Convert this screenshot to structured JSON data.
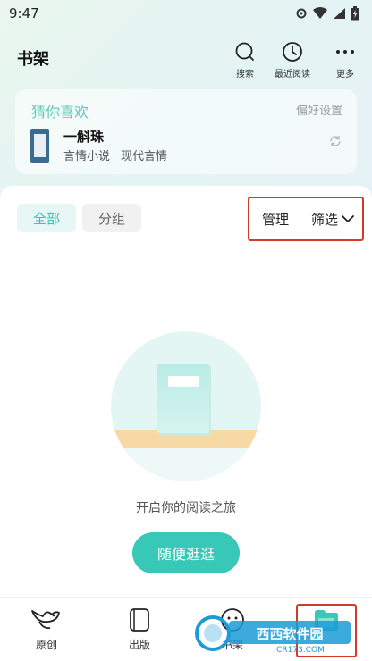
{
  "status_bar": {
    "time": "9:47"
  },
  "header": {
    "title": "书架",
    "actions": [
      {
        "label": "搜索",
        "icon": "search-icon"
      },
      {
        "label": "最近阅读",
        "icon": "clock-icon"
      },
      {
        "label": "更多",
        "icon": "more-icon"
      }
    ]
  },
  "recommend": {
    "title": "猜你喜欢",
    "preference": "偏好设置",
    "cover_text": "斛珠",
    "book_title": "一斛珠",
    "tags": [
      "言情小说",
      "现代言情"
    ]
  },
  "tabs": [
    {
      "label": "全部",
      "active": true
    },
    {
      "label": "分组",
      "active": false
    }
  ],
  "manage": {
    "manage_label": "管理",
    "filter_label": "筛选"
  },
  "empty_state": {
    "message": "开启你的阅读之旅",
    "button_label": "随便逛逛"
  },
  "bottom_nav": [
    {
      "label": "原创",
      "icon": "bird-icon"
    },
    {
      "label": "出版",
      "icon": "book-icon"
    },
    {
      "label": "书架",
      "icon": "chat-icon"
    },
    {
      "label": "",
      "icon": "folder-icon"
    }
  ],
  "watermark": {
    "brand": "西西软件园",
    "url": "CR173.COM"
  },
  "colors": {
    "accent": "#37c8b8",
    "highlight_box": "#d43a2a"
  }
}
